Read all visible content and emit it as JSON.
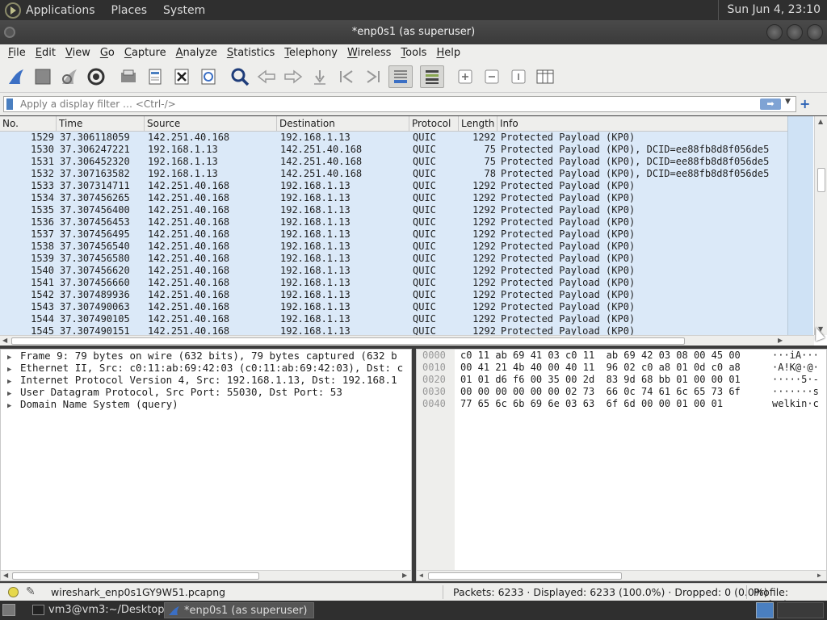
{
  "top_panel": {
    "menus": [
      "Applications",
      "Places",
      "System"
    ],
    "clock": "Sun Jun  4, 23:10"
  },
  "window": {
    "title": "*enp0s1 (as superuser)"
  },
  "menubar": {
    "items": [
      "File",
      "Edit",
      "View",
      "Go",
      "Capture",
      "Analyze",
      "Statistics",
      "Telephony",
      "Wireless",
      "Tools",
      "Help"
    ]
  },
  "toolbar": {
    "icons": [
      "shark-fin-start-icon",
      "stop-icon",
      "restart-icon",
      "options-gear-icon",
      "open-folder-icon",
      "save-file-icon",
      "close-file-icon",
      "reload-icon",
      "find-icon",
      "go-back-icon",
      "go-forward-icon",
      "go-to-packet-icon",
      "first-packet-icon",
      "last-packet-icon",
      "autoscroll-icon",
      "colorize-icon",
      "zoom-in-icon",
      "zoom-out-icon",
      "zoom-normal-icon",
      "resize-columns-icon"
    ]
  },
  "filter": {
    "placeholder": "Apply a display filter … <Ctrl-/>"
  },
  "packet_list": {
    "columns": [
      "No.",
      "Time",
      "Source",
      "Destination",
      "Protocol",
      "Length",
      "Info"
    ],
    "rows": [
      [
        "1529",
        "37.306118059",
        "142.251.40.168",
        "192.168.1.13",
        "QUIC",
        "1292",
        "Protected Payload (KP0)"
      ],
      [
        "1530",
        "37.306247221",
        "192.168.1.13",
        "142.251.40.168",
        "QUIC",
        "75",
        "Protected Payload (KP0), DCID=ee88fb8d8f056de5"
      ],
      [
        "1531",
        "37.306452320",
        "192.168.1.13",
        "142.251.40.168",
        "QUIC",
        "75",
        "Protected Payload (KP0), DCID=ee88fb8d8f056de5"
      ],
      [
        "1532",
        "37.307163582",
        "192.168.1.13",
        "142.251.40.168",
        "QUIC",
        "78",
        "Protected Payload (KP0), DCID=ee88fb8d8f056de5"
      ],
      [
        "1533",
        "37.307314711",
        "142.251.40.168",
        "192.168.1.13",
        "QUIC",
        "1292",
        "Protected Payload (KP0)"
      ],
      [
        "1534",
        "37.307456265",
        "142.251.40.168",
        "192.168.1.13",
        "QUIC",
        "1292",
        "Protected Payload (KP0)"
      ],
      [
        "1535",
        "37.307456400",
        "142.251.40.168",
        "192.168.1.13",
        "QUIC",
        "1292",
        "Protected Payload (KP0)"
      ],
      [
        "1536",
        "37.307456453",
        "142.251.40.168",
        "192.168.1.13",
        "QUIC",
        "1292",
        "Protected Payload (KP0)"
      ],
      [
        "1537",
        "37.307456495",
        "142.251.40.168",
        "192.168.1.13",
        "QUIC",
        "1292",
        "Protected Payload (KP0)"
      ],
      [
        "1538",
        "37.307456540",
        "142.251.40.168",
        "192.168.1.13",
        "QUIC",
        "1292",
        "Protected Payload (KP0)"
      ],
      [
        "1539",
        "37.307456580",
        "142.251.40.168",
        "192.168.1.13",
        "QUIC",
        "1292",
        "Protected Payload (KP0)"
      ],
      [
        "1540",
        "37.307456620",
        "142.251.40.168",
        "192.168.1.13",
        "QUIC",
        "1292",
        "Protected Payload (KP0)"
      ],
      [
        "1541",
        "37.307456660",
        "142.251.40.168",
        "192.168.1.13",
        "QUIC",
        "1292",
        "Protected Payload (KP0)"
      ],
      [
        "1542",
        "37.307489936",
        "142.251.40.168",
        "192.168.1.13",
        "QUIC",
        "1292",
        "Protected Payload (KP0)"
      ],
      [
        "1543",
        "37.307490063",
        "142.251.40.168",
        "192.168.1.13",
        "QUIC",
        "1292",
        "Protected Payload (KP0)"
      ],
      [
        "1544",
        "37.307490105",
        "142.251.40.168",
        "192.168.1.13",
        "QUIC",
        "1292",
        "Protected Payload (KP0)"
      ],
      [
        "1545",
        "37.307490151",
        "142.251.40.168",
        "192.168.1.13",
        "QUIC",
        "1292",
        "Protected Payload (KP0)"
      ]
    ],
    "row_color": "#dbe9f8"
  },
  "details": {
    "items": [
      "Frame 9: 79 bytes on wire (632 bits), 79 bytes captured (632 b",
      "Ethernet II, Src: c0:11:ab:69:42:03 (c0:11:ab:69:42:03), Dst: c",
      "Internet Protocol Version 4, Src: 192.168.1.13, Dst: 192.168.1",
      "User Datagram Protocol, Src Port: 55030, Dst Port: 53",
      "Domain Name System (query)"
    ]
  },
  "bytes": {
    "offsets": [
      "0000",
      "0010",
      "0020",
      "0030",
      "0040"
    ],
    "hex": [
      "c0 11 ab 69 41 03 c0 11  ab 69 42 03 08 00 45 00",
      "00 41 21 4b 40 00 40 11  96 02 c0 a8 01 0d c0 a8",
      "01 01 d6 f6 00 35 00 2d  83 9d 68 bb 01 00 00 01",
      "00 00 00 00 00 00 02 73  66 0c 74 61 6c 65 73 6f",
      "77 65 6c 6b 69 6e 03 63  6f 6d 00 00 01 00 01"
    ],
    "ascii": [
      "···iA···",
      "·A!K@·@·",
      "·····5·-",
      "·······s",
      "welkin·c"
    ]
  },
  "statusbar": {
    "file": "wireshark_enp0s1GY9W51.pcapng",
    "packets": "Packets: 6233 · Displayed: 6233 (100.0%) · Dropped: 0 (0.0%)",
    "profile": "Profile: Default"
  },
  "taskbar": {
    "tasks": [
      "vm3@vm3:~/Desktop",
      "*enp0s1 (as superuser)"
    ]
  }
}
